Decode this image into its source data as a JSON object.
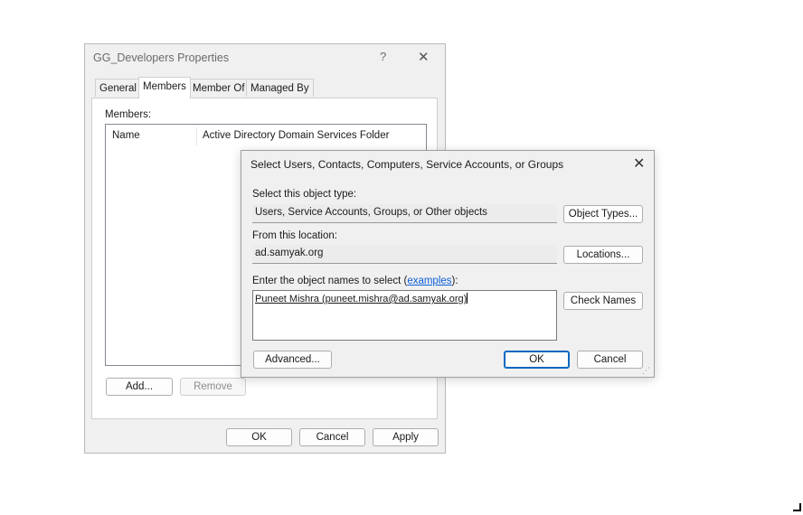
{
  "properties_window": {
    "title": "GG_Developers Properties",
    "help_glyph": "?",
    "close_glyph": "✕",
    "tabs": [
      {
        "label": "General"
      },
      {
        "label": "Members"
      },
      {
        "label": "Member Of"
      },
      {
        "label": "Managed By"
      }
    ],
    "active_tab": "Members",
    "members_label": "Members:",
    "columns": [
      "Name",
      "Active Directory Domain Services Folder"
    ],
    "add_button": "Add...",
    "remove_button": "Remove",
    "ok_button": "OK",
    "cancel_button": "Cancel",
    "apply_button": "Apply"
  },
  "select_dialog": {
    "title": "Select Users, Contacts, Computers, Service Accounts, or Groups",
    "close_glyph": "✕",
    "object_type_label": "Select this object type:",
    "object_type_value": "Users, Service Accounts, Groups, or Other objects",
    "object_types_button": "Object Types...",
    "location_label": "From this location:",
    "location_value": "ad.samyak.org",
    "locations_button": "Locations...",
    "enter_names_prefix": "Enter the object names to select (",
    "enter_names_link": "examples",
    "enter_names_suffix": "):",
    "names_value": "Puneet Mishra (puneet.mishra@ad.samyak.org)",
    "check_names_button": "Check Names",
    "advanced_button": "Advanced...",
    "ok_button": "OK",
    "cancel_button": "Cancel"
  }
}
